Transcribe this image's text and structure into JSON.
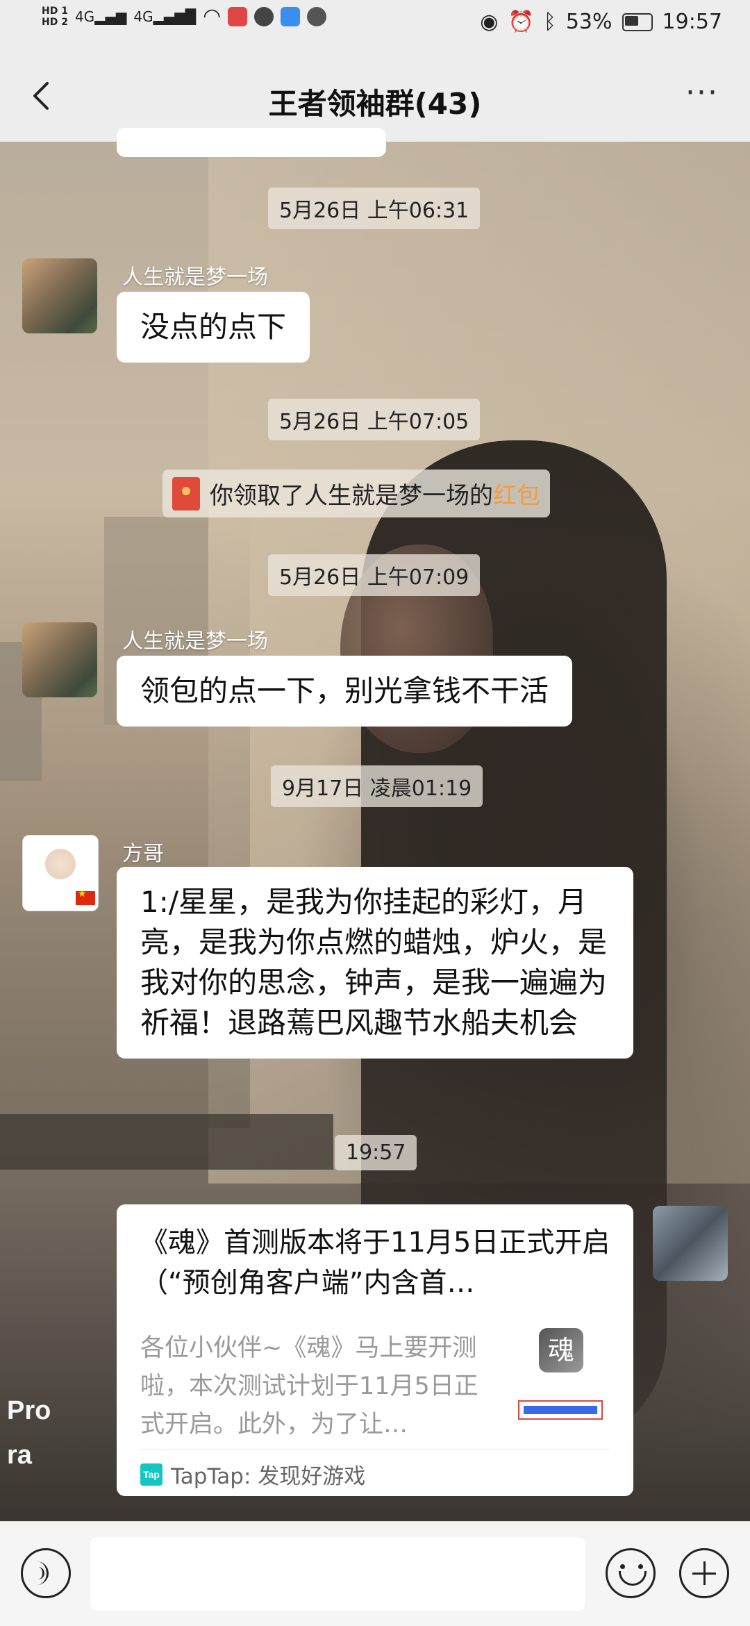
{
  "status_bar": {
    "hd1": "HD 1",
    "hd2": "HD 2",
    "signal1": "4G",
    "signal2": "4G",
    "battery": "53%",
    "time": "19:57"
  },
  "header": {
    "title": "王者领袖群(43)",
    "back_icon": "chevron-left-icon",
    "more_icon": "more-dots-icon"
  },
  "messages": {
    "t1": "5月26日 上午06:31",
    "m1_sender": "人生就是梦一场",
    "m1_text": "没点的点下",
    "t2": "5月26日 上午07:05",
    "sys_text": "你领取了人生就是梦一场的",
    "sys_highlight": "红包",
    "t3": "5月26日 上午07:09",
    "m2_sender": "人生就是梦一场",
    "m2_text": "领包的点一下，别光拿钱不干活",
    "t4": "9月17日 凌晨01:19",
    "m3_sender": "方哥",
    "m3_text": "1:/星星，是我为你挂起的彩灯，月亮，是我为你点燃的蜡烛，炉火，是我对你的思念，钟声，是我一遍遍为祈福！退路蔫巴风趣节水船夫机会",
    "t5": "19:57"
  },
  "card": {
    "title": "《魂》首测版本将于11月5日正式开启（“预创角客户端”内含首…",
    "description": "各位小伙伴~《魂》马上要开测啦，本次测试计划于11月5日正式开启。此外，为了让…",
    "thumb_logo": "魂",
    "footer": "TapTap: 发现好游戏",
    "footer_icon": "Tap"
  },
  "background_watermark": {
    "line1": "Pro",
    "line2": "ra"
  }
}
